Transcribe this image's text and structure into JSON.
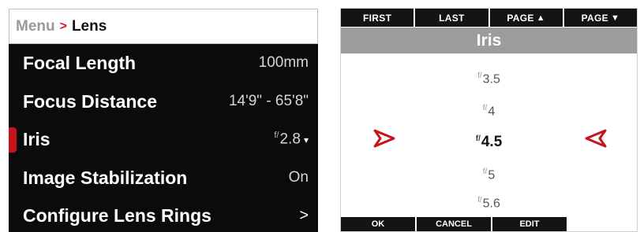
{
  "lens_menu": {
    "breadcrumb": {
      "root": "Menu",
      "separator": ">",
      "current": "Lens"
    },
    "items": [
      {
        "label": "Focal Length",
        "value": "100mm",
        "fstop_prefix": "",
        "trailing": ""
      },
      {
        "label": "Focus Distance",
        "value": "14'9\" - 65'8\"",
        "fstop_prefix": "",
        "trailing": ""
      },
      {
        "label": "Iris",
        "value": "2.8",
        "fstop_prefix": "f/",
        "trailing": "▾",
        "selected": true
      },
      {
        "label": "Image Stabilization",
        "value": "On",
        "fstop_prefix": "",
        "trailing": ""
      },
      {
        "label": "Configure Lens Rings",
        "value": "",
        "fstop_prefix": "",
        "trailing": ">"
      }
    ]
  },
  "iris_picker": {
    "top_buttons": [
      {
        "label": "FIRST",
        "icon": ""
      },
      {
        "label": "LAST",
        "icon": ""
      },
      {
        "label": "PAGE",
        "icon": "▲"
      },
      {
        "label": "PAGE",
        "icon": "▼"
      }
    ],
    "title": "Iris",
    "fstop_prefix": "f/",
    "options": [
      "3.5",
      "4",
      "4.5",
      "5",
      "5.6"
    ],
    "selected_option": "4.5",
    "bottom_buttons": [
      "OK",
      "CANCEL",
      "EDIT"
    ]
  },
  "colors": {
    "accent_red": "#c8131b",
    "panel_black": "#0b0b0b",
    "title_gray": "#9c9c9c"
  },
  "icons": {
    "breadcrumb_separator": "chevron-right-icon",
    "selection_left": "triangle-arrow-right-icon",
    "selection_right": "triangle-arrow-left-icon"
  }
}
